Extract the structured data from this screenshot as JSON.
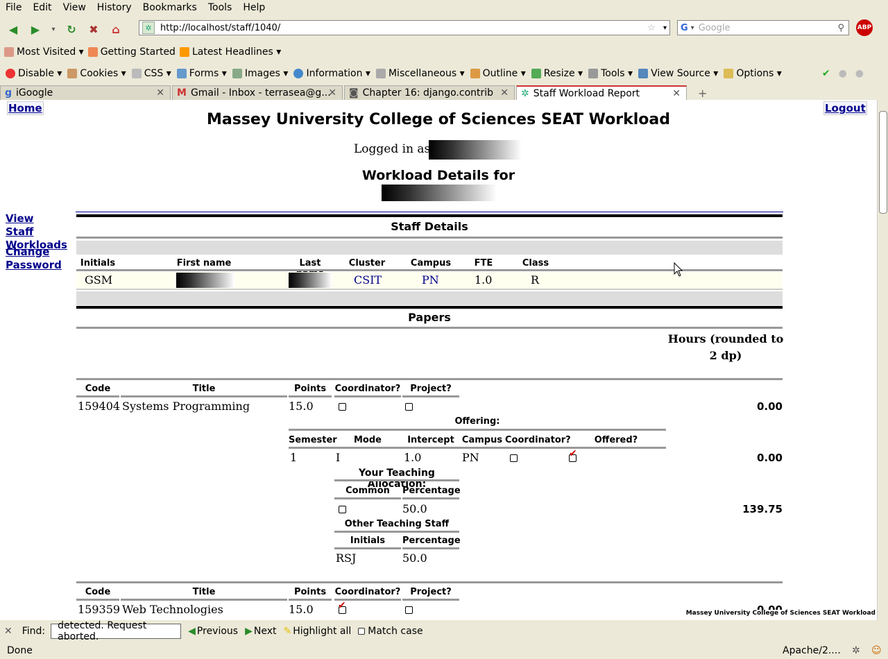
{
  "menus": [
    "File",
    "Edit",
    "View",
    "History",
    "Bookmarks",
    "Tools",
    "Help"
  ],
  "url": "http://localhost/staff/1040/",
  "search_placeholder": "Google",
  "bookmarks": [
    "Most Visited",
    "Getting Started",
    "Latest Headlines"
  ],
  "devtools": [
    "Disable",
    "Cookies",
    "CSS",
    "Forms",
    "Images",
    "Information",
    "Miscellaneous",
    "Outline",
    "Resize",
    "Tools",
    "View Source",
    "Options"
  ],
  "tabs": [
    "iGoogle",
    "Gmail - Inbox - terrasea@g...",
    "Chapter 16: django.contrib",
    "Staff Workload Report"
  ],
  "page": {
    "home": "Home",
    "logout": "Logout",
    "title": "Massey University College of Sciences SEAT Workload",
    "logged_in": "Logged in as",
    "details_for": "Workload Details for",
    "side_view": "View Staff Workloads",
    "side_change": "Change Password",
    "staff_details": "Staff Details",
    "staff_headers": [
      "Initials",
      "First name",
      "Last name",
      "Cluster",
      "Campus",
      "FTE",
      "Class"
    ],
    "staff_row": {
      "initials": "GSM",
      "cluster": "CSIT",
      "campus": "PN",
      "fte": "1.0",
      "class": "R"
    },
    "papers": "Papers",
    "hours_head": "Hours (rounded to 2 dp)",
    "paper_headers": [
      "Code",
      "Title",
      "Points",
      "Coordinator?",
      "Project?"
    ],
    "paper1": {
      "code": "159404",
      "title": "Systems Programming",
      "points": "15.0",
      "hours": "0.00",
      "coordinator": false,
      "project": false
    },
    "offering": "Offering:",
    "offering_headers": [
      "Semester",
      "Mode",
      "Intercept",
      "Campus",
      "Coordinator?",
      "Offered?"
    ],
    "offering_row": {
      "semester": "1",
      "mode": "I",
      "intercept": "1.0",
      "campus": "PN",
      "hours": "0.00",
      "coordinator": false,
      "offered": true
    },
    "alloc_title": "Your Teaching Allocation:",
    "alloc_headers": [
      "Common",
      "Percentage"
    ],
    "alloc_row": {
      "percentage": "50.0",
      "hours": "139.75",
      "common": false
    },
    "other_staff": "Other Teaching Staff",
    "other_headers": [
      "Initials",
      "Percentage"
    ],
    "other_row": {
      "initials": "RSJ",
      "percentage": "50.0"
    },
    "paper2": {
      "code": "159359",
      "title": "Web Technologies",
      "points": "15.0",
      "hours": "0.00",
      "coordinator": true,
      "project": false
    },
    "footer": "Massey University College of Sciences SEAT Workload"
  },
  "find": {
    "label": "Find:",
    "value": "detected. Request aborted.",
    "previous": "Previous",
    "next": "Next",
    "highlight": "Highlight all",
    "match": "Match case"
  },
  "status": {
    "left": "Done",
    "right": "Apache/2...."
  }
}
